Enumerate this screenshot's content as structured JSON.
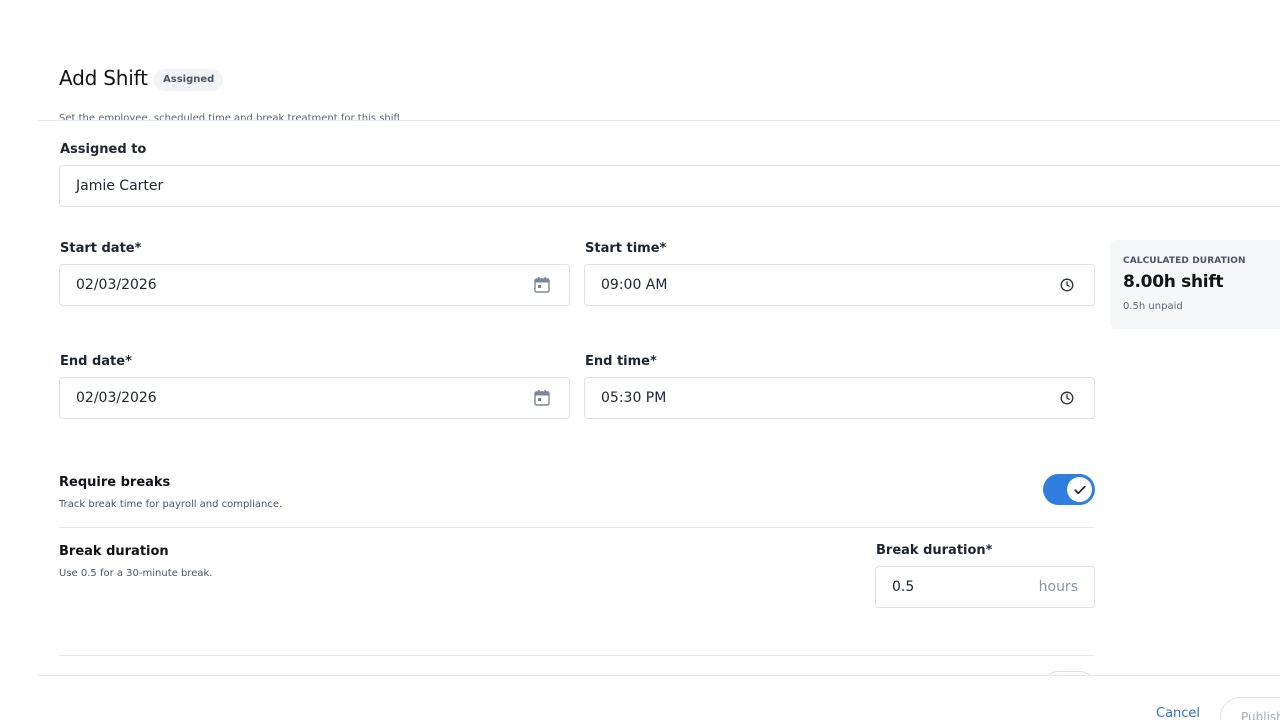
{
  "header": {
    "title": "Add Shift",
    "badge": "Assigned",
    "subtitle": "Set the employee, scheduled time and break treatment for this shift."
  },
  "assigned_to": {
    "label": "Assigned to",
    "value": "Jamie Carter"
  },
  "start": {
    "date_label": "Start date*",
    "date_value": "02/03/2026",
    "time_label": "Start time*",
    "time_value": "09:00 AM"
  },
  "end": {
    "date_label": "End date*",
    "date_value": "02/03/2026",
    "time_label": "End time*",
    "time_value": "05:30 PM"
  },
  "duration_card": {
    "caption": "CALCULATED DURATION",
    "value": "8.00h shift",
    "note": "0.5h unpaid"
  },
  "breaks": {
    "title": "Require breaks",
    "description": "Track break time for payroll and compliance.",
    "enabled": true
  },
  "break_duration": {
    "title": "Break duration",
    "description": "Use 0.5 for a 30-minute break.",
    "field_label": "Break duration*",
    "value": "0.5",
    "unit": "hours"
  },
  "footer": {
    "cancel_label": "Cancel",
    "publish_label": "Publish"
  },
  "colors": {
    "accent": "#2f7ee0",
    "link": "#2f6fd1"
  },
  "icons": {
    "date": "calendar-icon",
    "time": "clock-icon",
    "toggle": "checkmark-icon"
  }
}
